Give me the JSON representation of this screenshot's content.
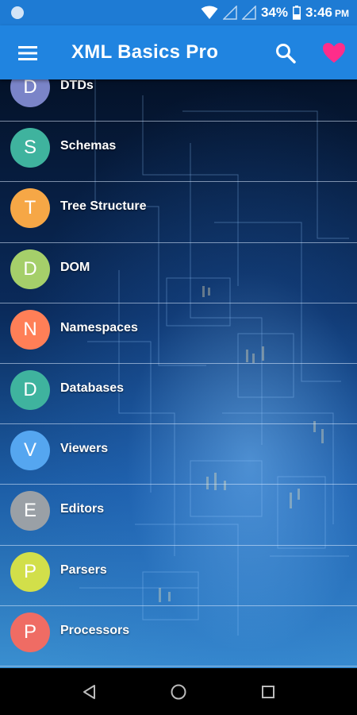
{
  "status_bar": {
    "battery": "34%",
    "time": "3:46",
    "ampm": "PM"
  },
  "app_bar": {
    "title": "XML Basics Pro",
    "colors": {
      "bar": "#2084e0",
      "favorite": "#ff2d8a"
    }
  },
  "topics": [
    {
      "letter": "D",
      "label": "DTDs",
      "color": "#7a84c8"
    },
    {
      "letter": "S",
      "label": "Schemas",
      "color": "#3fb39e"
    },
    {
      "letter": "T",
      "label": "Tree Structure",
      "color": "#f6a746"
    },
    {
      "letter": "D",
      "label": "DOM",
      "color": "#a5cf6a"
    },
    {
      "letter": "N",
      "label": "Namespaces",
      "color": "#ff7f57"
    },
    {
      "letter": "D",
      "label": "Databases",
      "color": "#3fb39e"
    },
    {
      "letter": "V",
      "label": "Viewers",
      "color": "#55a6f0"
    },
    {
      "letter": "E",
      "label": "Editors",
      "color": "#9aa0a6"
    },
    {
      "letter": "P",
      "label": "Parsers",
      "color": "#d2df4a"
    },
    {
      "letter": "P",
      "label": "Processors",
      "color": "#ef6c64"
    }
  ]
}
